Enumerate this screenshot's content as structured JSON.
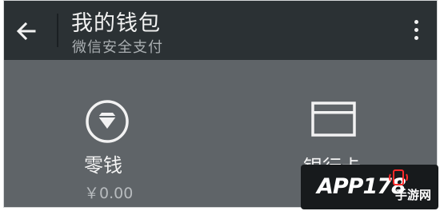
{
  "appbar": {
    "title": "我的钱包",
    "subtitle": "微信安全支付",
    "back_icon": "arrow-left-icon",
    "more_icon": "more-vertical-icon"
  },
  "wallet": {
    "change": {
      "label": "零钱",
      "amount": "￥0.00",
      "icon": "diamond-circle-icon"
    },
    "bank_card": {
      "label": "银行卡",
      "icon": "card-icon"
    }
  },
  "watermark": {
    "text": "APP178",
    "sub": "手游网"
  },
  "colors": {
    "appbar_bg": "#2b3134",
    "content_bg": "#5f6468",
    "text_primary": "#f4f4f4",
    "text_secondary": "#a9aeb1"
  }
}
